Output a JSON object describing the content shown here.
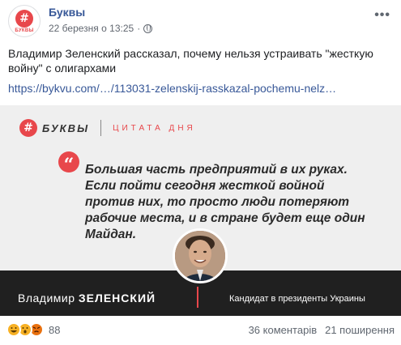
{
  "post": {
    "page_name": "Буквы",
    "date": "22 березня о 13:25",
    "separator": "·",
    "more": "•••",
    "text": "Владимир Зеленский рассказал, почему нельзя устраивать \"жесткую войну\" с олигархами",
    "link": "https://bykvu.com/…/113031-zelenskij-rasskazal-pochemu-nelz…",
    "avatar_symbol": "#",
    "avatar_text": "БУКВЫ"
  },
  "card": {
    "brand_symbol": "#",
    "brand_name": "БУКВЫ",
    "brand_tagline": "ЦИТАТА ДНЯ",
    "quote_symbol": "“",
    "quote": "Большая часть предприятий в их руках. Если пойти сегодня жесткой войной против них, то просто люди потеряют рабочие места, и в стране будет еще один Майдан.",
    "person_first": "Владимир",
    "person_last": "ЗЕЛЕНСКИЙ",
    "person_role": "Кандидат в президенты Украины"
  },
  "engagement": {
    "reaction_count": "88",
    "reactions": [
      "haha",
      "wow",
      "angry"
    ],
    "comments": "36 коментарів",
    "shares": "21 поширення"
  },
  "colors": {
    "accent": "#e8474b",
    "link": "#385898",
    "footer_bg": "#202020",
    "card_bg": "#efefef"
  }
}
